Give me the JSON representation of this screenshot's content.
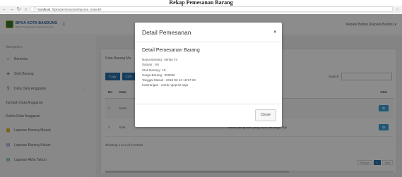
{
  "caption": "Rekap Pemesanan Barang",
  "browser": {
    "url_host": "localhost",
    "url_path": "/bpka/pemesanan/laporan_masuk#"
  },
  "header": {
    "brand_name": "BPKA KOTA BANDUNG",
    "brand_sub": "Badan Pengelolaan Keuangan dan Aset",
    "user_menu": "Kepala Badan (Kepala Badan) ▾"
  },
  "sidebar": {
    "heading": "Navigation",
    "items": [
      {
        "label": "Beranda"
      },
      {
        "label": "Stok Barang"
      },
      {
        "label": "Data Data Anggaran"
      },
      {
        "label": "Tambah Data Anggaran"
      },
      {
        "label": "Kelola Data Anggaran"
      },
      {
        "label": "Laporan Barang Masuk"
      },
      {
        "label": "Laporan Barang Keluar"
      },
      {
        "label": "Laporan Akhir Tahun"
      }
    ]
  },
  "main": {
    "panel_title": "Data Barang Ma",
    "buttons": [
      "Copy",
      "CSV"
    ],
    "search_label": "Search:",
    "columns": {
      "no": "No",
      "nama": "Nam",
      "keterangan": "angan",
      "aksi": "Aksi"
    },
    "rows": [
      {
        "no": "1",
        "nama": "kerta",
        "keterangan": "ngeprint saja"
      },
      {
        "no": "2",
        "nama": "tinta",
        "keterangan": "arena jika printer yang lolas berfungsi lagi"
      }
    ],
    "showing": "Showing 1 to 2 of 2 entries",
    "pager": {
      "prev": "Previous",
      "page": "1",
      "next": "Next"
    }
  },
  "modal": {
    "title": "Detail Pemesanan",
    "close_x": "×",
    "subtitle": "Detail Pemesanan Barang",
    "lines": [
      "Nama Barang : kertas F4",
      "Satuan : rim",
      "Stok Barang : 18",
      "Harga Barang : 800000",
      "Tanggal Masuk : 2018-06-13 18:57:33",
      "Keterangan : untuk ngeprint saja"
    ],
    "close_button": "Close"
  }
}
